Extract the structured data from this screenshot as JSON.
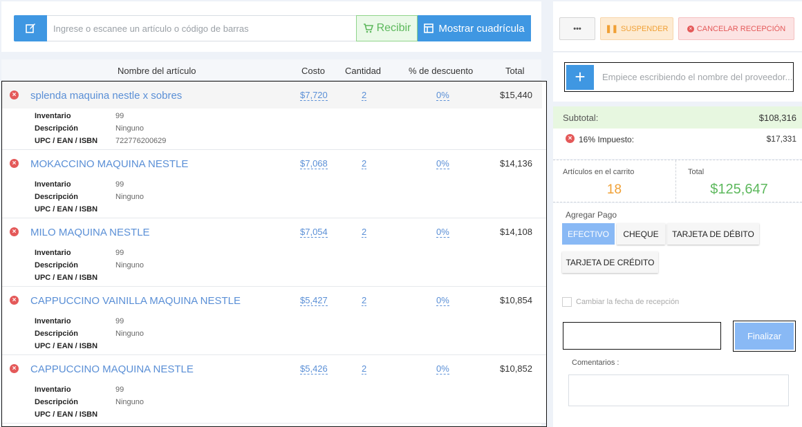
{
  "search": {
    "placeholder": "Ingrese o escanee un artículo o código de barras",
    "receive_label": "Recibir",
    "grid_label": "Mostrar cuadrícula"
  },
  "table": {
    "headers": {
      "name": "Nombre del artículo",
      "cost": "Costo",
      "qty": "Cantidad",
      "discount": "% de descuento",
      "total": "Total"
    },
    "detail_labels": {
      "inventory": "Inventario",
      "description": "Descripción",
      "upc": "UPC / EAN / ISBN"
    },
    "items": [
      {
        "name": "splenda maquina nestle x sobres",
        "cost": "$7,720",
        "qty": "2",
        "discount": "0%",
        "total": "$15,440",
        "inventory": "99",
        "description": "Ninguno",
        "upc": "722776200629"
      },
      {
        "name": "MOKACCINO MAQUINA NESTLE",
        "cost": "$7,068",
        "qty": "2",
        "discount": "0%",
        "total": "$14,136",
        "inventory": "99",
        "description": "Ninguno",
        "upc": ""
      },
      {
        "name": "MILO MAQUINA NESTLE",
        "cost": "$7,054",
        "qty": "2",
        "discount": "0%",
        "total": "$14,108",
        "inventory": "99",
        "description": "Ninguno",
        "upc": ""
      },
      {
        "name": "CAPPUCCINO VAINILLA MAQUINA NESTLE",
        "cost": "$5,427",
        "qty": "2",
        "discount": "0%",
        "total": "$10,854",
        "inventory": "99",
        "description": "Ninguno",
        "upc": ""
      },
      {
        "name": "CAPPUCCINO MAQUINA NESTLE",
        "cost": "$5,426",
        "qty": "2",
        "discount": "0%",
        "total": "$10,852",
        "inventory": "99",
        "description": "Ninguno",
        "upc": ""
      }
    ]
  },
  "actions": {
    "more_label": "•••",
    "suspend_label": "SUSPENDER",
    "cancel_label": "CANCELAR RECEPCIÓN"
  },
  "supplier": {
    "placeholder": "Empiece escribiendo el nombre del proveedor..."
  },
  "summary": {
    "subtotal_label": "Subtotal:",
    "subtotal_value": "$108,316",
    "tax_label": "16% Impuesto:",
    "tax_value": "$17,331",
    "items_label": "Artículos en el carrito",
    "items_value": "18",
    "total_label": "Total",
    "total_value": "$125,647"
  },
  "payment": {
    "label": "Agregar Pago",
    "methods": [
      "EFECTIVO",
      "CHEQUE",
      "TARJETA DE DÉBITO",
      "TARJETA DE CRÉDITO"
    ],
    "change_date_label": "Cambiar la fecha de recepción",
    "finalize_label": "Finalizar",
    "comments_label": "Comentarios :"
  },
  "colors": {
    "primary": "#3f97e2",
    "link": "#5a8fd6",
    "success": "#5cb85c",
    "warning": "#f0a035",
    "danger": "#e45959"
  }
}
